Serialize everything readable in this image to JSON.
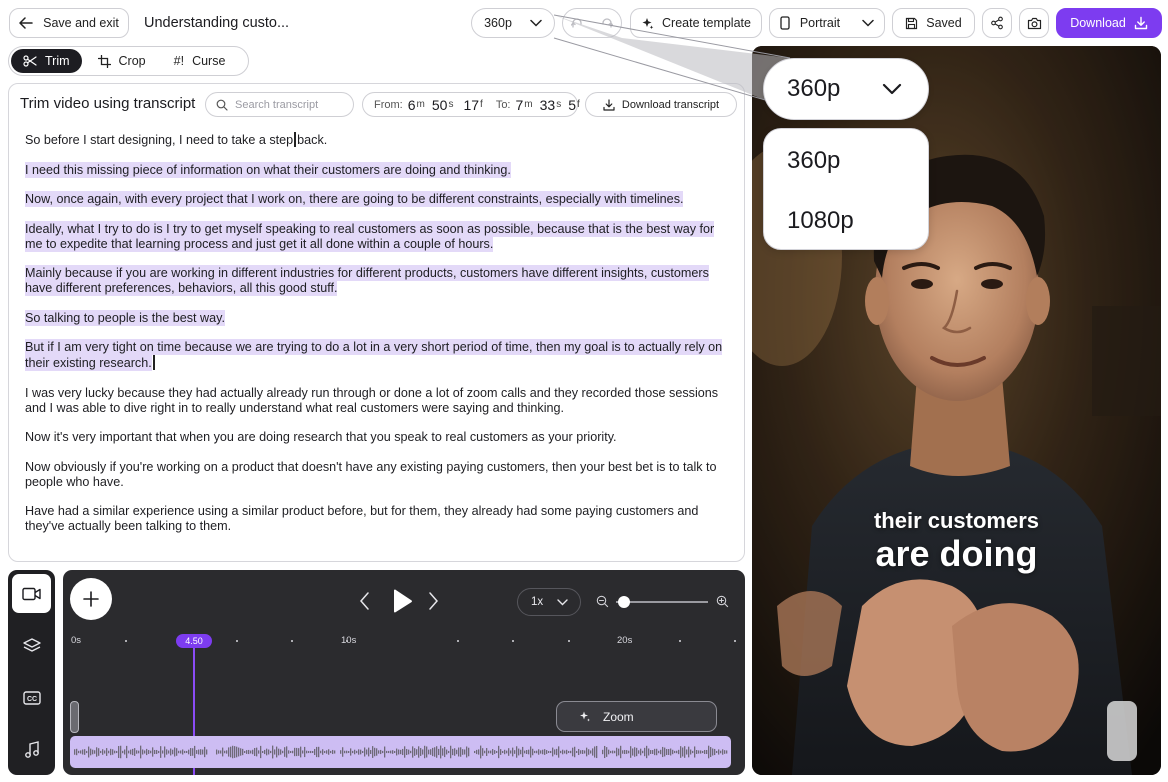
{
  "header": {
    "save_exit_label": "Save and exit",
    "doc_title": "Understanding custo...",
    "resolution_value": "360p",
    "create_template_label": "Create template",
    "aspect_label": "Portrait",
    "saved_label": "Saved",
    "download_label": "Download"
  },
  "tools": {
    "tabs": [
      {
        "label": "Trim",
        "icon": "scissors-icon",
        "active": true
      },
      {
        "label": "Crop",
        "icon": "crop-icon",
        "active": false
      },
      {
        "label": "Curse",
        "icon": "hash-bang-icon",
        "active": false
      }
    ]
  },
  "transcript": {
    "title": "Trim video using transcript",
    "search_placeholder": "Search transcript",
    "from_label": "From:",
    "from_m": "6",
    "from_s": "50",
    "from_f": "17",
    "to_label": "To:",
    "to_m": "7",
    "to_s": "33",
    "to_f": "5",
    "unit_m": "m",
    "unit_s": "s",
    "unit_f": "f",
    "download_label": "Download transcript",
    "lines": [
      {
        "a": "So before I start designing, I need to take a step",
        "b": "back.",
        "highlight": false
      },
      {
        "a": "I need this missing piece of information on what their customers are doing and thinking.",
        "highlight": true
      },
      {
        "a": "Now, once again, with every project that I work on, there are going to be different constraints, especially with timelines.",
        "highlight": true
      },
      {
        "a": "Ideally, what I try to do is I try to get myself speaking to real customers as soon as possible, because that is the best way for me to expedite that learning process and just get it all done within a couple of hours.",
        "highlight": true
      },
      {
        "a": "Mainly because if you are working in different industries for different products, customers have different insights, customers have different preferences, behaviors, all this good stuff.",
        "highlight": true
      },
      {
        "a": "So talking to people is the best way.",
        "highlight": true
      },
      {
        "a": "But if I am very tight on time because we are trying to do a lot in a very short period of time, then my goal is to actually rely on their existing research.",
        "highlight": true
      },
      {
        "a": "I was very lucky because they had actually already run through or done a lot of zoom calls and they recorded those sessions and I was able to dive right in to really understand what real customers were saying and thinking.",
        "highlight": false
      },
      {
        "a": "Now it's very important that when you are doing research that you speak to real customers as your priority.",
        "highlight": false
      },
      {
        "a": "Now obviously if you're working on a product that doesn't have any existing paying customers, then your best bet is to talk to people who have.",
        "highlight": false
      },
      {
        "a": "Have had a similar experience using a similar product before, but for them, they already had some paying customers and they've actually been talking to them.",
        "highlight": false
      }
    ]
  },
  "dock": {
    "items": [
      "video-icon",
      "layers-icon",
      "captions-icon",
      "music-icon"
    ]
  },
  "timeline": {
    "speed": "1x",
    "playhead_label": "4.50",
    "tick_labels": [
      "0s",
      "10s",
      "20s"
    ],
    "zoom_label": "Zoom"
  },
  "video": {
    "caption_line1": "their customers",
    "caption_line2": "are doing"
  },
  "resolution_menu": {
    "selected": "360p",
    "options": [
      "360p",
      "1080p"
    ]
  },
  "colors": {
    "accent": "#7d3cf0",
    "highlight": "#e3d9f8",
    "dark_panel": "#2b2b2e",
    "waveform": "#cdbdf3"
  }
}
